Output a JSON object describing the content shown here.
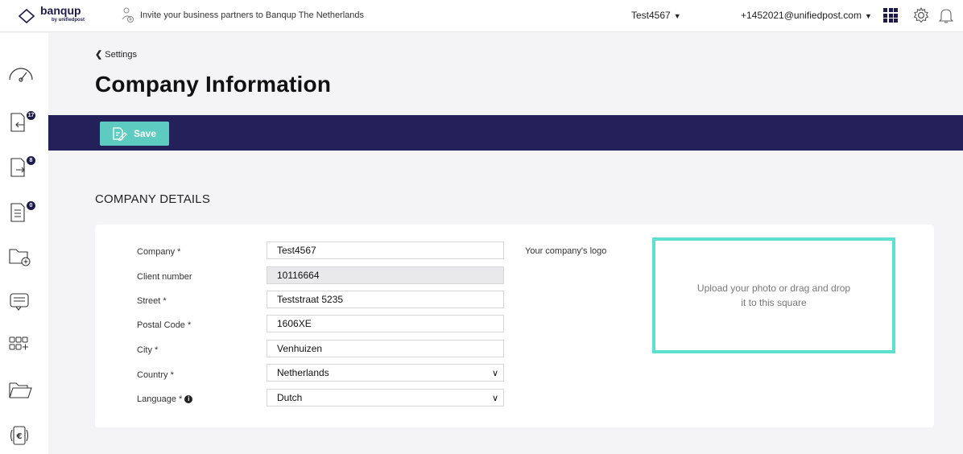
{
  "header": {
    "brand": "banqup",
    "brand_sub": "by unifiedpost",
    "invite_text": "Invite your business partners to Banqup The Netherlands",
    "company": "Test4567",
    "user": "+1452021@unifiedpost.com"
  },
  "sidebar": {
    "items": [
      {
        "icon": "dashboard-gauge-icon",
        "badge": ""
      },
      {
        "icon": "inbox-documents-icon",
        "badge": "17"
      },
      {
        "icon": "outbox-documents-icon",
        "badge": "8"
      },
      {
        "icon": "document-list-icon",
        "badge": "0"
      },
      {
        "icon": "add-folder-icon",
        "badge": ""
      },
      {
        "icon": "messages-icon",
        "badge": ""
      },
      {
        "icon": "apps-icon",
        "badge": ""
      },
      {
        "icon": "folder-icon",
        "badge": ""
      },
      {
        "icon": "payment-icon",
        "badge": ""
      }
    ]
  },
  "page": {
    "back_label": "Settings",
    "title": "Company Information",
    "save_label": "Save",
    "section_title": "COMPANY DETAILS"
  },
  "form": {
    "company_label": "Company *",
    "company_value": "Test4567",
    "client_number_label": "Client number",
    "client_number_value": "10116664",
    "street_label": "Street *",
    "street_value": "Teststraat 5235",
    "postal_label": "Postal Code *",
    "postal_value": "1606XE",
    "city_label": "City *",
    "city_value": "Venhuizen",
    "country_label": "Country *",
    "country_value": "Netherlands",
    "language_label": "Language *",
    "language_value": "Dutch",
    "logo_label": "Your company's logo",
    "upload_text": "Upload your photo or drag and drop it to this square"
  },
  "colors": {
    "navy": "#24215a",
    "teal": "#5ecbc0",
    "dropzone_border": "#5ee0d0"
  }
}
